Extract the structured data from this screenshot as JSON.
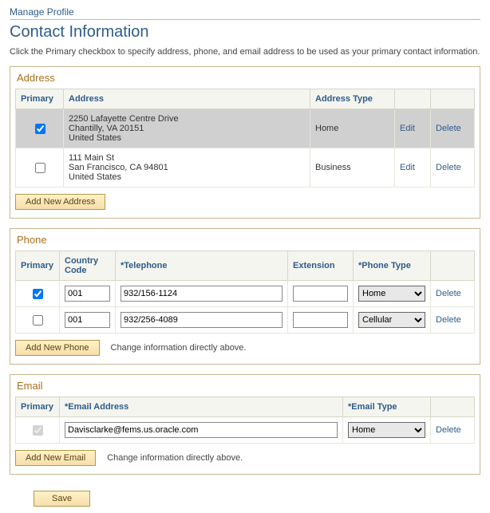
{
  "breadcrumb": "Manage Profile",
  "page_title": "Contact Information",
  "intro": "Click the Primary checkbox to specify address, phone, and email address to be used as your primary contact information.",
  "address": {
    "section_label": "Address",
    "columns": {
      "primary": "Primary",
      "address": "Address",
      "type": "Address Type",
      "blank1": " ",
      "blank2": " "
    },
    "rows": [
      {
        "primary_checked": true,
        "line1": "2250 Lafayette Centre Drive",
        "line2": "Chantilly, VA 20151",
        "line3": "United States",
        "type": "Home",
        "edit": "Edit",
        "delete": "Delete"
      },
      {
        "primary_checked": false,
        "line1": "111 Main St",
        "line2": "San Francisco, CA 94801",
        "line3": "United States",
        "type": "Business",
        "edit": "Edit",
        "delete": "Delete"
      }
    ],
    "add_btn": "Add New Address"
  },
  "phone": {
    "section_label": "Phone",
    "columns": {
      "primary": "Primary",
      "country": "Country Code",
      "telephone": "*Telephone",
      "extension": "Extension",
      "type": "*Phone Type",
      "blank": " "
    },
    "rows": [
      {
        "primary_checked": true,
        "country": "001",
        "telephone": "932/156-1124",
        "extension": "",
        "type": "Home",
        "delete": "Delete"
      },
      {
        "primary_checked": false,
        "country": "001",
        "telephone": "932/256-4089",
        "extension": "",
        "type": "Cellular",
        "delete": "Delete"
      }
    ],
    "add_btn": "Add New Phone",
    "note": "Change information directly above."
  },
  "email": {
    "section_label": "Email",
    "columns": {
      "primary": "Primary",
      "address": "*Email Address",
      "type": "*Email Type",
      "blank": " "
    },
    "rows": [
      {
        "primary_checked": true,
        "address": "Davisclarke@fems.us.oracle.com",
        "type": "Home",
        "delete": "Delete"
      }
    ],
    "add_btn": "Add New Email",
    "note": "Change information directly above."
  },
  "save_btn": "Save"
}
